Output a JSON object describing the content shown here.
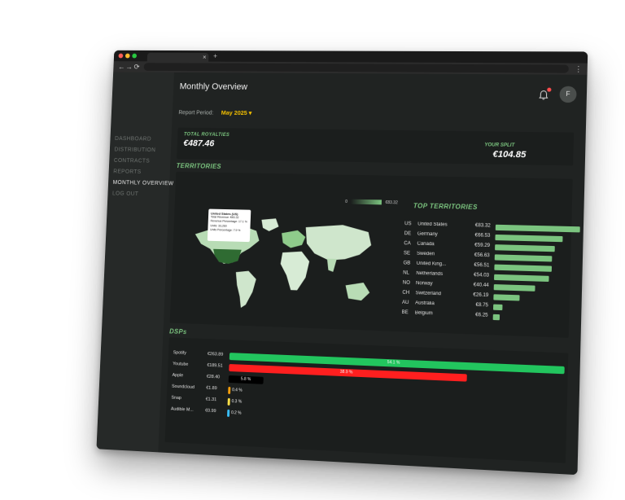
{
  "browser": {
    "window_dots": [
      "#ff5f57",
      "#febc2e",
      "#28c840"
    ],
    "tab_close": "×",
    "new_tab": "+",
    "back": "←",
    "forward": "→",
    "reload": "⟳",
    "menu": "⋮"
  },
  "sidebar": {
    "items": [
      {
        "label": "DASHBOARD",
        "active": false
      },
      {
        "label": "DISTRIBUTION",
        "active": false
      },
      {
        "label": "CONTRACTS",
        "active": false
      },
      {
        "label": "REPORTS",
        "active": false
      },
      {
        "label": "MONTHLY OVERVIEW",
        "active": true
      },
      {
        "label": "LOG OUT",
        "active": false
      }
    ]
  },
  "header": {
    "title": "Monthly Overview",
    "avatar_initial": "F",
    "bell_icon": "bell-icon"
  },
  "report_period": {
    "label": "Report Period:",
    "value": "May 2025 ▾"
  },
  "royalties": {
    "total_label": "TOTAL ROYALTIES",
    "total_value": "€487.46",
    "split_label": "YOUR SPLIT",
    "split_value": "€104.85"
  },
  "territories": {
    "title": "TERRITORIES",
    "legend_min": "0",
    "legend_max": "€83.32",
    "tooltip": {
      "title": "United States (US)",
      "lines": [
        "Total Revenue: €83.32",
        "Revenue Percentage: 17.1 %",
        "Units: 33,260",
        "Units Percentage: 7.9 %"
      ]
    },
    "top_title": "TOP TERRITORIES",
    "top": [
      {
        "code": "US",
        "name": "United States",
        "value": "€83.32",
        "amount": 83.32
      },
      {
        "code": "DE",
        "name": "Germany",
        "value": "€66.53",
        "amount": 66.53
      },
      {
        "code": "CA",
        "name": "Canada",
        "value": "€59.29",
        "amount": 59.29
      },
      {
        "code": "SE",
        "name": "Sweden",
        "value": "€56.63",
        "amount": 56.63
      },
      {
        "code": "GB",
        "name": "United King...",
        "value": "€56.51",
        "amount": 56.51
      },
      {
        "code": "NL",
        "name": "Netherlands",
        "value": "€54.03",
        "amount": 54.03
      },
      {
        "code": "NO",
        "name": "Norway",
        "value": "€40.44",
        "amount": 40.44
      },
      {
        "code": "CH",
        "name": "Switzerland",
        "value": "€26.19",
        "amount": 26.19
      },
      {
        "code": "AU",
        "name": "Australia",
        "value": "€8.75",
        "amount": 8.75
      },
      {
        "code": "BE",
        "name": "Belgium",
        "value": "€6.25",
        "amount": 6.25
      }
    ]
  },
  "dsps": {
    "title": "DSPs",
    "rows": [
      {
        "name": "Spotify",
        "value": "€263.89",
        "pct_label": "54.1 %",
        "pct": 54.1,
        "color": "#22c55e"
      },
      {
        "name": "Youtube",
        "value": "€189.51",
        "pct_label": "38.9 %",
        "pct": 38.9,
        "color": "#ff1f1f"
      },
      {
        "name": "Apple",
        "value": "€28.40",
        "pct_label": "5.8 %",
        "pct": 5.8,
        "color": "#000000"
      },
      {
        "name": "Soundcloud",
        "value": "€1.89",
        "pct_label": "0.4 %",
        "pct": 0.4,
        "color": "#f59e0b"
      },
      {
        "name": "Snap",
        "value": "€1.31",
        "pct_label": "0.3 %",
        "pct": 0.3,
        "color": "#fde047"
      },
      {
        "name": "Audible M...",
        "value": "€0.99",
        "pct_label": "0.2 %",
        "pct": 0.2,
        "color": "#38bdf8"
      }
    ]
  }
}
